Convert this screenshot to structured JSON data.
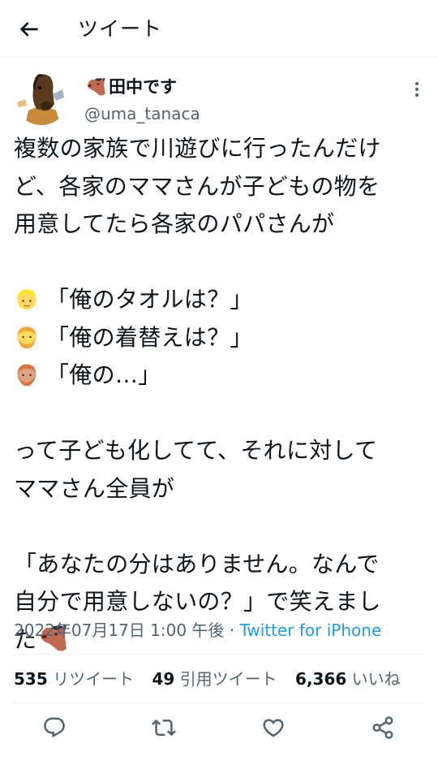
{
  "header": {
    "title": "ツイート"
  },
  "author": {
    "name": "田中です",
    "handle": "@uma_tanaca"
  },
  "tweet": {
    "line1": "複数の家族で川遊びに行ったんだけ",
    "line2": "ど、各家のママさんが子どもの物を",
    "line3": "用意してたら各家のパパさんが",
    "quote1": "「俺のタオルは？」",
    "quote2": "「俺の着替えは？」",
    "quote3": "「俺の…」",
    "line4": "って子ども化してて、それに対して",
    "line5": "ママさん全員が",
    "line6": "「あなたの分はありません。なんで",
    "line7": "自分で用意しないの？」で笑えまし",
    "line8": "た"
  },
  "meta": {
    "timestamp": "2022年07月17日 1:00 午後 · ",
    "source": "Twitter for iPhone"
  },
  "stats": {
    "retweets": "535",
    "retweets_label": "リツイート",
    "quotes": "49",
    "quotes_label": "引用ツイート",
    "likes": "6,366",
    "likes_label": "いいね"
  },
  "colors": {
    "text": "#0f1419",
    "secondary": "#536471",
    "link": "#1d9bf0",
    "divider": "#eff3f4"
  }
}
